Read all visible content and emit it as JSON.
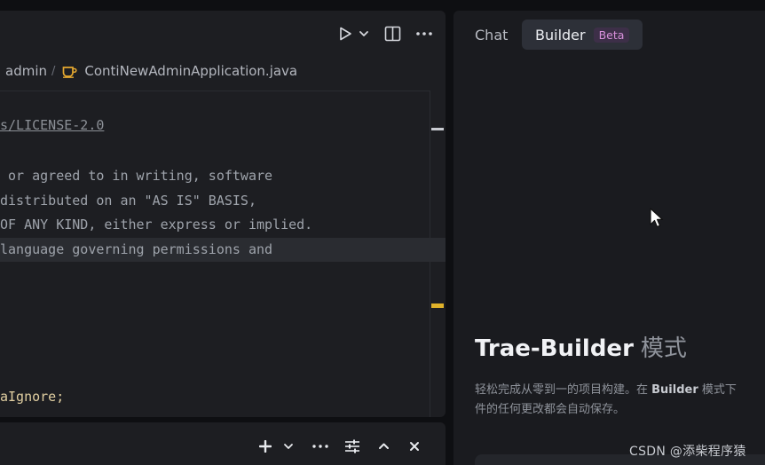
{
  "colors": {
    "background": "#0e0f12",
    "panel": "#1d1e22",
    "java_icon": "#e5a830",
    "scroll_marker_current": "#c9ccd2",
    "scroll_marker_warning": "#e0b22a",
    "beta_badge_text": "#d68fd9"
  },
  "editor": {
    "toolbar": {
      "run_icon": "play-icon",
      "run_options_icon": "chevron-down-icon",
      "split_icon": "split-editor-icon",
      "more_icon": "more-horizontal-icon"
    },
    "breadcrumb": {
      "items": [
        "admin"
      ],
      "separator": "/",
      "file_icon": "java-coffee-icon",
      "file": "ContiNewAdminApplication.java"
    },
    "code_lines": [
      "s/LICENSE-2.0",
      "",
      " or agreed to in writing, software",
      "distributed on an \"AS IS\" BASIS,",
      "OF ANY KIND, either express or implied.",
      "language governing permissions and",
      "",
      "",
      "",
      "",
      "aIgnore;"
    ]
  },
  "bottom_bar": {
    "add_icon": "plus-icon",
    "add_options_icon": "chevron-down-icon",
    "more_icon": "more-horizontal-icon",
    "settings_icon": "sliders-icon",
    "maximize_icon": "chevron-up-icon",
    "close_icon": "close-icon"
  },
  "assistant": {
    "tabs": {
      "chat": "Chat",
      "builder": "Builder",
      "beta": "Beta"
    },
    "headline": {
      "name": "Trae-Builder",
      "mode": "模式"
    },
    "description": {
      "line1_pre": "轻松完成从零到一的项目构建。在 ",
      "line1_bold": "Builder",
      "line1_post": " 模式下",
      "line2": "件的任何更改都会自动保存。"
    }
  },
  "watermark": "CSDN @添柴程序猿"
}
